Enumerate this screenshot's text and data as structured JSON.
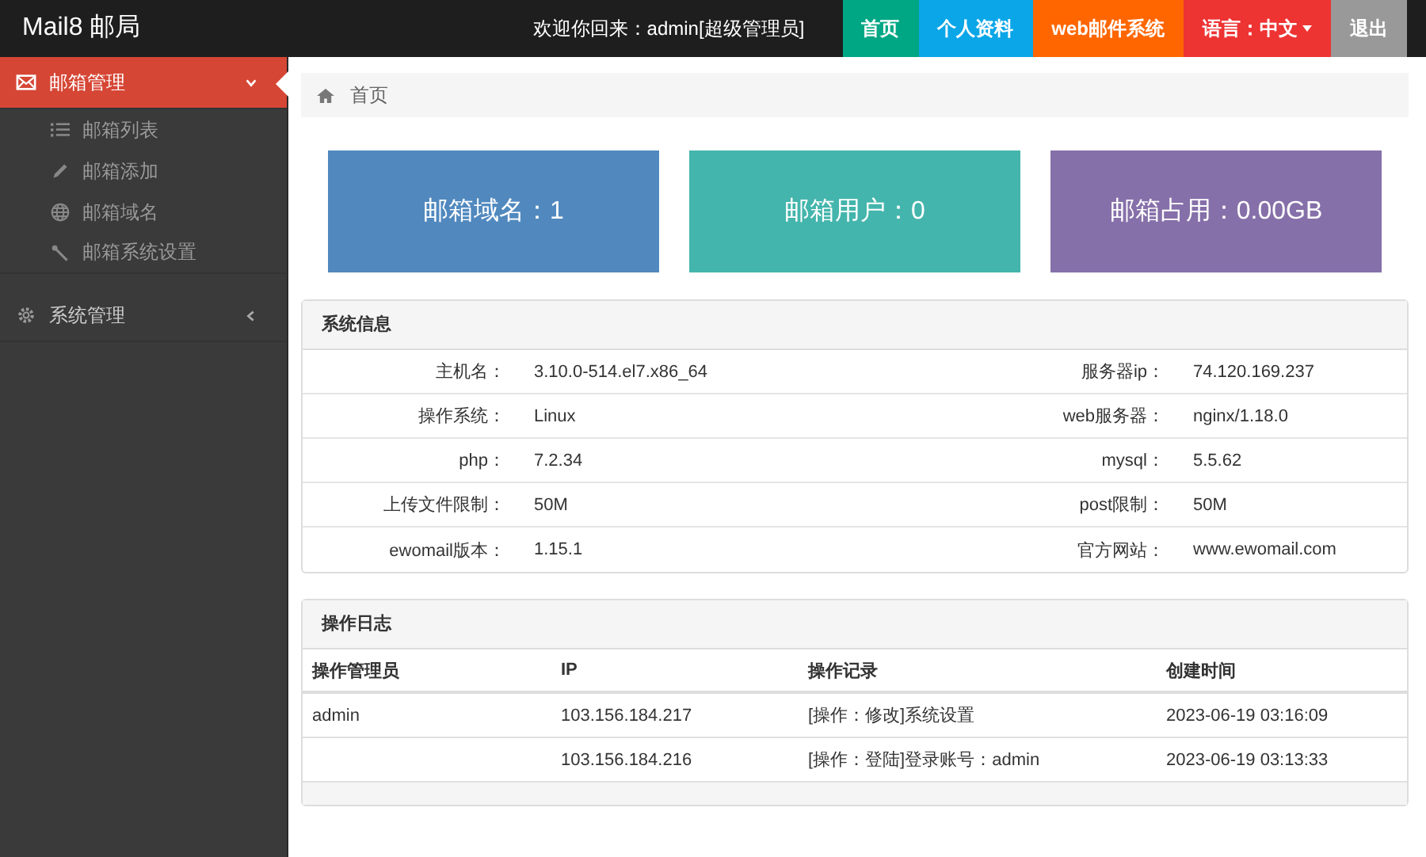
{
  "brand": "Mail8 邮局",
  "welcome": "欢迎你回来：admin[超级管理员]",
  "nav": [
    {
      "label": "首页",
      "color": "#00a784"
    },
    {
      "label": "个人资料",
      "color": "#0aa6e8"
    },
    {
      "label": "web邮件系统",
      "color": "#ff6600"
    },
    {
      "label": "语言：中文",
      "color": "#ee3333",
      "dropdown": true
    },
    {
      "label": "退出",
      "color": "#999999"
    }
  ],
  "sidebar": {
    "items": [
      {
        "label": "邮箱管理",
        "expanded": true,
        "selected": true,
        "children": [
          {
            "label": "邮箱列表"
          },
          {
            "label": "邮箱添加"
          },
          {
            "label": "邮箱域名"
          },
          {
            "label": "邮箱系统设置"
          }
        ]
      },
      {
        "label": "系统管理",
        "expanded": false,
        "selected": false
      }
    ]
  },
  "breadcrumb": "首页",
  "stats": [
    {
      "label": "邮箱域名：1",
      "color": "#5189bf"
    },
    {
      "label": "邮箱用户：0",
      "color": "#44b5ac"
    },
    {
      "label": "邮箱占用：0.00GB",
      "color": "#8670a9"
    }
  ],
  "system_info": {
    "title": "系统信息",
    "rows": [
      [
        "主机名：",
        "3.10.0-514.el7.x86_64",
        "服务器ip：",
        "74.120.169.237"
      ],
      [
        "操作系统：",
        "Linux",
        "web服务器：",
        "nginx/1.18.0"
      ],
      [
        "php：",
        "7.2.34",
        "mysql：",
        "5.5.62"
      ],
      [
        "上传文件限制：",
        "50M",
        "post限制：",
        "50M"
      ],
      [
        "ewomail版本：",
        "1.15.1",
        "官方网站：",
        "www.ewomail.com"
      ]
    ]
  },
  "log": {
    "title": "操作日志",
    "columns": [
      "操作管理员",
      "IP",
      "操作记录",
      "创建时间"
    ],
    "rows": [
      [
        "admin",
        "103.156.184.217",
        "[操作：修改]系统设置",
        "2023-06-19 03:16:09"
      ],
      [
        "",
        "103.156.184.216",
        "[操作：登陆]登录账号：admin",
        "2023-06-19 03:13:33"
      ]
    ]
  }
}
